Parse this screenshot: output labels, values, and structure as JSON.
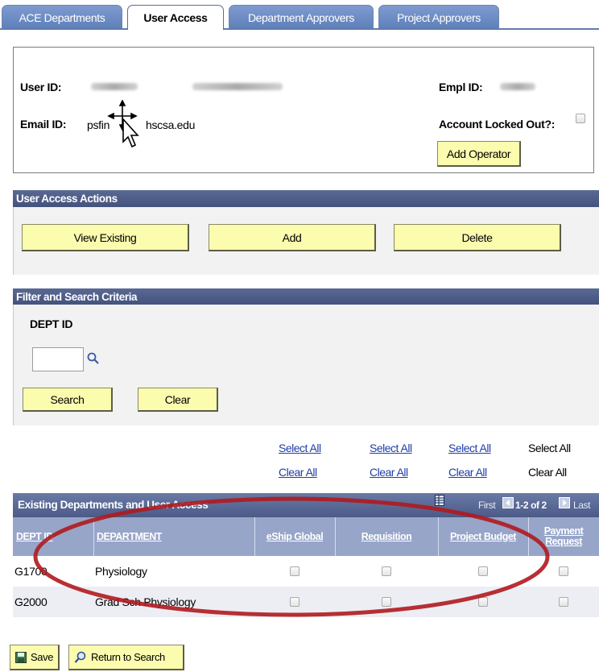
{
  "tabs": [
    {
      "label": "ACE Departments",
      "active": false
    },
    {
      "label": "User Access",
      "active": true
    },
    {
      "label": "Department Approvers",
      "active": false
    },
    {
      "label": "Project Approvers",
      "active": false
    }
  ],
  "user_info": {
    "user_id_label": "User ID:",
    "empl_id_label": "Empl ID:",
    "email_label": "Email ID:",
    "email_value_start": "psfin",
    "email_value_end": "hscsa.edu",
    "locked_label": "Account Locked Out?:",
    "locked_checked": false,
    "add_operator": "Add Operator"
  },
  "actions": {
    "title": "User Access Actions",
    "view_existing": "View Existing",
    "add": "Add",
    "delete": "Delete"
  },
  "filter": {
    "title": "Filter and Search Criteria",
    "dept_id_label": "DEPT ID",
    "dept_id_value": "",
    "search": "Search",
    "clear": "Clear"
  },
  "select_clear": {
    "select_all": "Select All",
    "clear_all": "Clear All"
  },
  "grid": {
    "title": "Existing Departments and User Access",
    "pager_first": "First",
    "pager_range": "1-2 of 2",
    "pager_last": "Last",
    "columns": [
      "DEPT ID",
      "DEPARTMENT",
      "eShip Global",
      "Requisition",
      "Project Budget",
      "Payment Request"
    ],
    "rows": [
      {
        "dept_id": "G1700",
        "department": "Physiology"
      },
      {
        "dept_id": "G2000",
        "department": "Grad Sch Physiology"
      }
    ]
  },
  "footer": {
    "save": "Save",
    "return_to_search": "Return to Search"
  },
  "colors": {
    "tab_inactive": "#6f8ec6",
    "panel_header": "#4f5d88",
    "button_yellow": "#fcfcaf",
    "link": "#1f3ea8",
    "annotation": "#b0191e"
  }
}
